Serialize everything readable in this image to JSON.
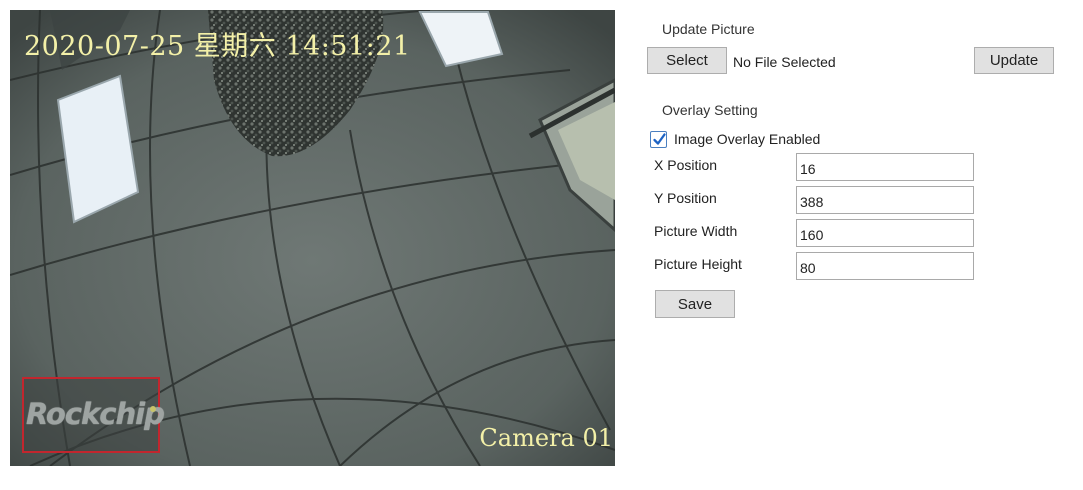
{
  "preview": {
    "osd_datetime": "2020-07-25 星期六 14:51:21",
    "osd_channel": "Camera 01",
    "overlay_logo": "Rockchip"
  },
  "update_picture": {
    "title": "Update Picture",
    "select_label": "Select",
    "file_status": "No File Selected",
    "update_label": "Update"
  },
  "overlay_setting": {
    "title": "Overlay Setting",
    "enabled_label": "Image Overlay Enabled",
    "enabled": true,
    "fields": {
      "x_position": {
        "label": "X Position",
        "value": "16"
      },
      "y_position": {
        "label": "Y Position",
        "value": "388"
      },
      "picture_width": {
        "label": "Picture Width",
        "value": "160"
      },
      "picture_height": {
        "label": "Picture Height",
        "value": "80"
      }
    },
    "save_label": "Save"
  },
  "colors": {
    "osd_text": "#f3f0a8",
    "overlay_border": "#c2262e",
    "checkbox_accent": "#1d63c4",
    "button_bg": "#e1e1e1"
  }
}
